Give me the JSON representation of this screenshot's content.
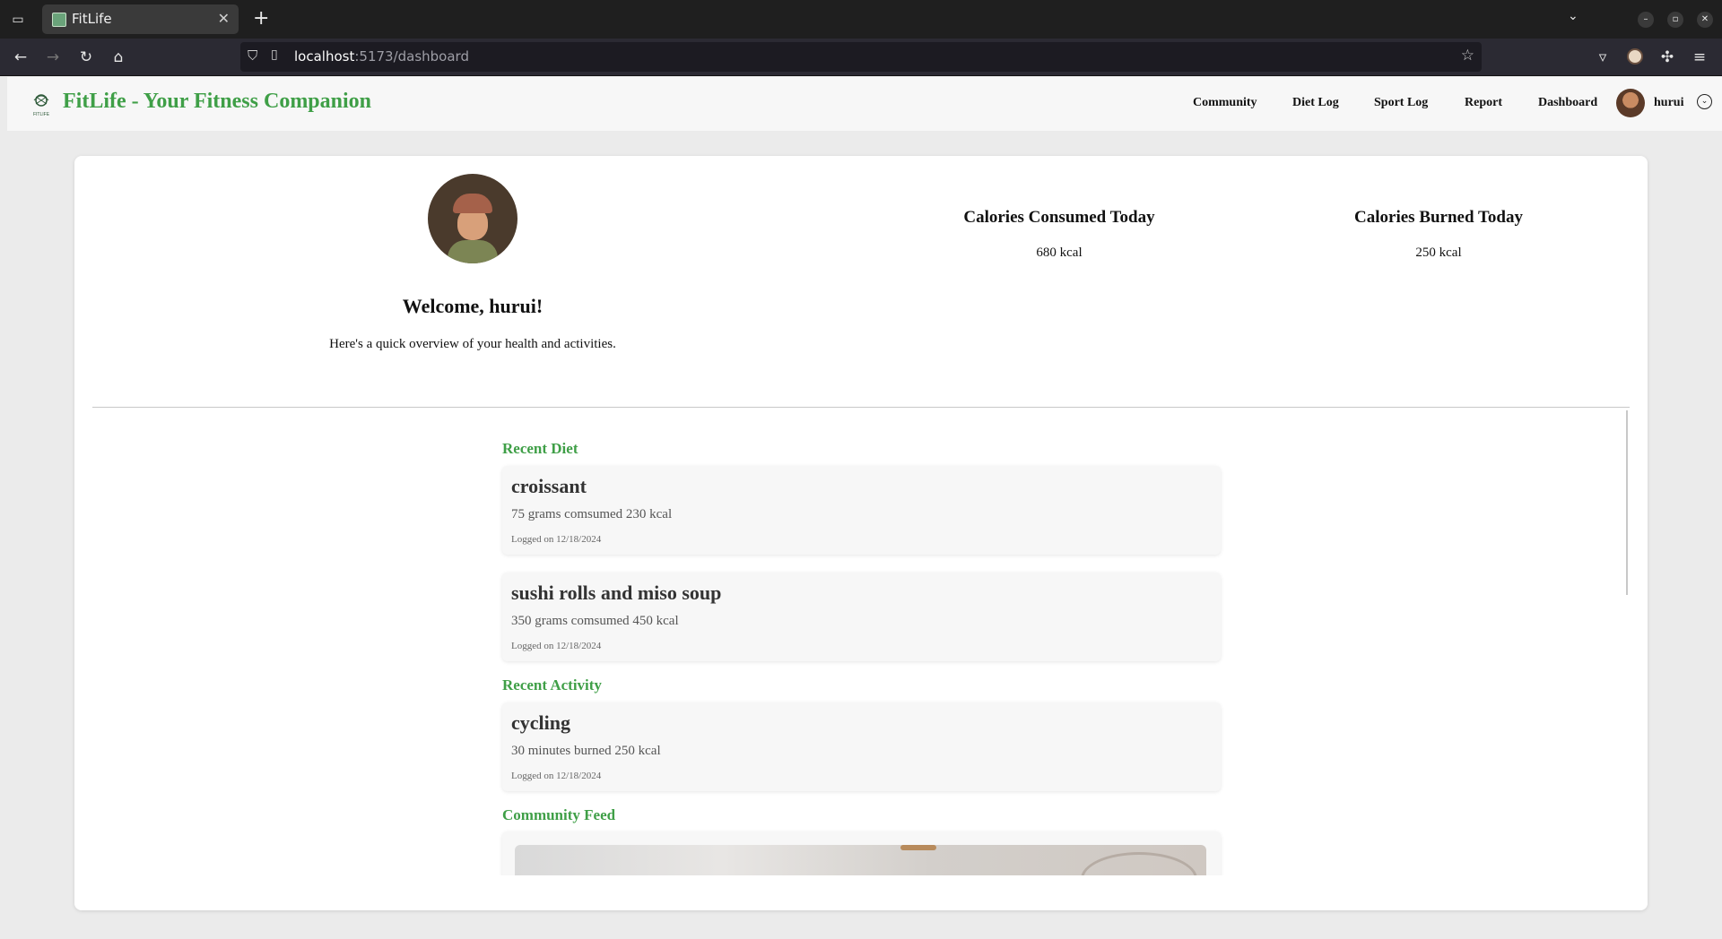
{
  "browser": {
    "tab_title": "FitLife",
    "url_host": "localhost",
    "url_path": ":5173/dashboard"
  },
  "app": {
    "brand": "FitLife - Your Fitness Companion",
    "logo_text": "FITLIFE",
    "nav": [
      "Community",
      "Diet Log",
      "Sport Log",
      "Report",
      "Dashboard"
    ],
    "username": "hurui",
    "accent_color": "#3f9f47"
  },
  "profile": {
    "welcome": "Welcome, hurui!",
    "subtitle": "Here's a quick overview of your health and activities."
  },
  "stats": {
    "consumed_title": "Calories Consumed Today",
    "consumed_value": "680 kcal",
    "burned_title": "Calories Burned Today",
    "burned_value": "250 kcal"
  },
  "sections": {
    "diet": "Recent Diet",
    "activity": "Recent Activity",
    "feed": "Community Feed"
  },
  "diet": [
    {
      "name": "croissant",
      "desc": "75 grams comsumed 230 kcal",
      "date": "Logged on 12/18/2024"
    },
    {
      "name": "sushi rolls and miso soup",
      "desc": "350 grams comsumed 450 kcal",
      "date": "Logged on 12/18/2024"
    }
  ],
  "activity": [
    {
      "name": "cycling",
      "desc": "30 minutes burned 250 kcal",
      "date": "Logged on 12/18/2024"
    }
  ]
}
